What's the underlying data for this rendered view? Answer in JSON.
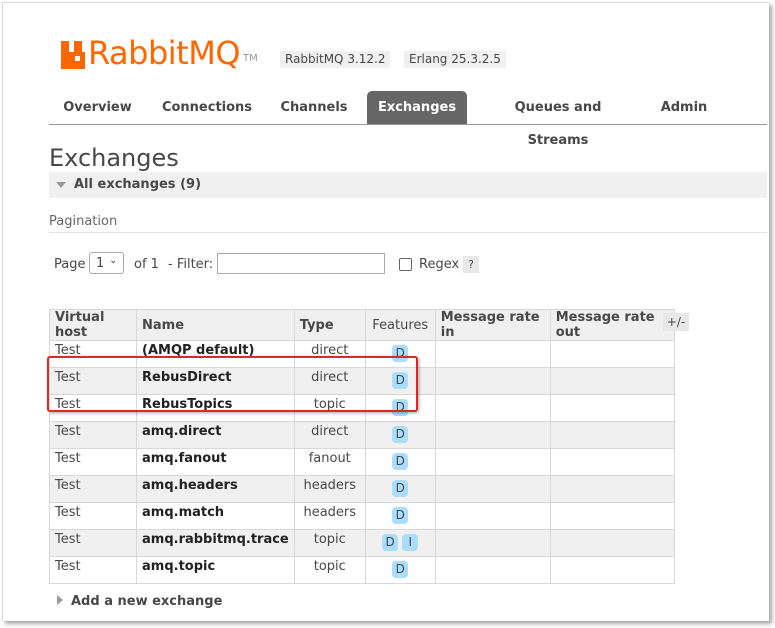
{
  "header": {
    "logo_text": "RabbitMQ",
    "logo_tm": "TM",
    "version": "RabbitMQ 3.12.2",
    "erlang": "Erlang 25.3.2.5"
  },
  "tabs": [
    {
      "label": "Overview",
      "active": false
    },
    {
      "label": "Connections",
      "active": false
    },
    {
      "label": "Channels",
      "active": false
    },
    {
      "label": "Exchanges",
      "active": true
    },
    {
      "label": "Queues and Streams",
      "active": false
    },
    {
      "label": "Admin",
      "active": false
    }
  ],
  "page_title": "Exchanges",
  "section": {
    "label": "All exchanges (9)"
  },
  "pagination": {
    "title": "Pagination",
    "page_label": "Page",
    "page_value": "1",
    "of_label": "of 1",
    "filter_label": "- Filter:",
    "filter_value": "",
    "regex_label": "Regex",
    "regex_checked": false,
    "help_label": "?"
  },
  "table": {
    "columns": [
      "Virtual host",
      "Name",
      "Type",
      "Features",
      "Message rate in",
      "Message rate out"
    ],
    "plusminus": "+/-",
    "rows": [
      {
        "vhost": "Test",
        "name": "(AMQP default)",
        "type": "direct",
        "features": [
          "D"
        ]
      },
      {
        "vhost": "Test",
        "name": "RebusDirect",
        "type": "direct",
        "features": [
          "D"
        ]
      },
      {
        "vhost": "Test",
        "name": "RebusTopics",
        "type": "topic",
        "features": [
          "D"
        ]
      },
      {
        "vhost": "Test",
        "name": "amq.direct",
        "type": "direct",
        "features": [
          "D"
        ]
      },
      {
        "vhost": "Test",
        "name": "amq.fanout",
        "type": "fanout",
        "features": [
          "D"
        ]
      },
      {
        "vhost": "Test",
        "name": "amq.headers",
        "type": "headers",
        "features": [
          "D"
        ]
      },
      {
        "vhost": "Test",
        "name": "amq.match",
        "type": "headers",
        "features": [
          "D"
        ]
      },
      {
        "vhost": "Test",
        "name": "amq.rabbitmq.trace",
        "type": "topic",
        "features": [
          "D",
          "I"
        ]
      },
      {
        "vhost": "Test",
        "name": "amq.topic",
        "type": "topic",
        "features": [
          "D"
        ]
      }
    ]
  },
  "add_new": {
    "label": "Add a new exchange"
  },
  "colors": {
    "brand": "#ff6600",
    "tab_active": "#666666",
    "badge": "#aaddff",
    "highlight": "#d62b2b"
  }
}
